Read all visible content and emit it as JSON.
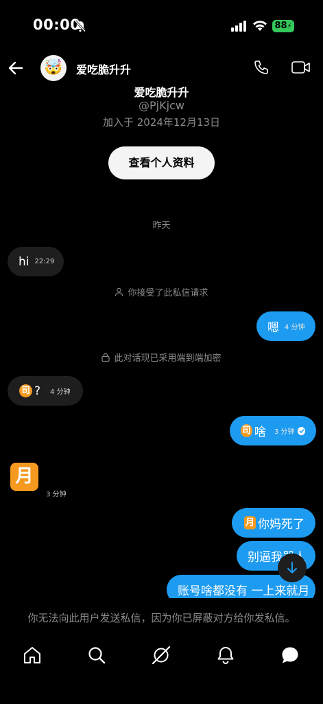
{
  "status_bar": {
    "time": "00:00",
    "battery": "88"
  },
  "header": {
    "name": "爱吃脆升升",
    "avatar_emoji": "🤯"
  },
  "profile": {
    "name": "爱吃脆升升",
    "handle": "@PjKjcw",
    "joined": "加入于 2024年12月13日",
    "view_profile_label": "查看个人资料"
  },
  "date_separator": "昨天",
  "system_messages": {
    "accepted": "你接受了此私信请求",
    "encrypted": "此对话现已采用端到端加密"
  },
  "messages": [
    {
      "dir": "in",
      "text": "hi",
      "time": "22:29"
    },
    {
      "dir": "out",
      "text": "嗯",
      "time": "4 分钟"
    },
    {
      "dir": "in",
      "emoji": "司",
      "text": "?",
      "time": "4 分钟"
    },
    {
      "dir": "out",
      "emoji": "司",
      "text": "啥",
      "time": "3 分钟",
      "seen": true
    },
    {
      "dir": "in",
      "emoji": "月",
      "time": "3 分钟"
    },
    {
      "dir": "out",
      "emoji": "月",
      "text": "你妈死了"
    },
    {
      "dir": "out",
      "text": "别逼我骂人"
    },
    {
      "dir": "out",
      "text": "账号啥都没有 一上来就月"
    }
  ],
  "blocked_notice": "你无法向此用户发送私信，因为你已屏蔽对方给你发私信。",
  "nav_icons": [
    "home-icon",
    "search-icon",
    "grok-icon",
    "notifications-icon",
    "messages-icon"
  ]
}
